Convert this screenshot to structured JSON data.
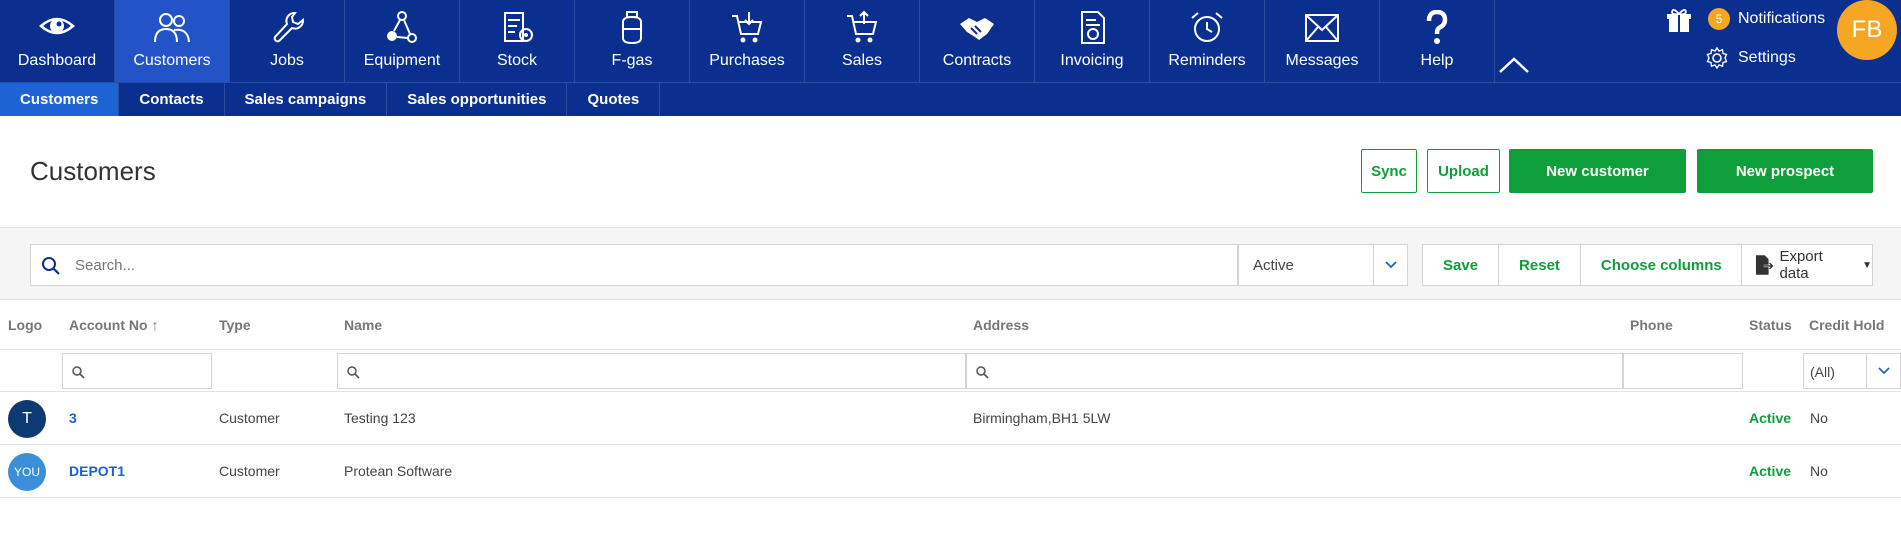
{
  "nav": {
    "items": [
      {
        "label": "Dashboard",
        "icon": "eye-icon"
      },
      {
        "label": "Customers",
        "icon": "users-icon"
      },
      {
        "label": "Jobs",
        "icon": "wrench-icon"
      },
      {
        "label": "Equipment",
        "icon": "equipment-icon"
      },
      {
        "label": "Stock",
        "icon": "stock-icon"
      },
      {
        "label": "F-gas",
        "icon": "gas-cylinder-icon"
      },
      {
        "label": "Purchases",
        "icon": "cart-in-icon"
      },
      {
        "label": "Sales",
        "icon": "cart-out-icon"
      },
      {
        "label": "Contracts",
        "icon": "handshake-icon"
      },
      {
        "label": "Invoicing",
        "icon": "invoice-icon"
      },
      {
        "label": "Reminders",
        "icon": "alarm-clock-icon"
      },
      {
        "label": "Messages",
        "icon": "envelope-icon"
      },
      {
        "label": "Help",
        "icon": "question-icon"
      }
    ],
    "active": "Customers",
    "notifications_label": "Notifications",
    "notifications_count": "5",
    "settings_label": "Settings",
    "user_initials": "FB"
  },
  "subnav": {
    "items": [
      "Customers",
      "Contacts",
      "Sales campaigns",
      "Sales opportunities",
      "Quotes"
    ],
    "active": "Customers"
  },
  "page": {
    "title": "Customers",
    "sync_label": "Sync",
    "upload_label": "Upload",
    "new_customer_label": "New customer",
    "new_prospect_label": "New prospect"
  },
  "filters": {
    "search_placeholder": "Search...",
    "status_value": "Active",
    "save_label": "Save",
    "reset_label": "Reset",
    "choose_columns_label": "Choose columns",
    "export_label": "Export data"
  },
  "table": {
    "columns": [
      "Logo",
      "Account No",
      "Type",
      "Name",
      "Address",
      "Phone",
      "Status",
      "Credit Hold"
    ],
    "credit_hold_filter": "(All)",
    "rows": [
      {
        "logo": "T",
        "logo_color": "#0d3a73",
        "account": "3",
        "type": "Customer",
        "name": "Testing 123",
        "address": "Birmingham,BH1 5LW",
        "phone": "",
        "status": "Active",
        "credit_hold": "No"
      },
      {
        "logo": "YOU",
        "logo_color": "#3a8fd8",
        "account": "DEPOT1",
        "type": "Customer",
        "name": "Protean Software",
        "address": "",
        "phone": "",
        "status": "Active",
        "credit_hold": "No"
      }
    ]
  },
  "colors": {
    "nav_bg": "#0a2f8f",
    "nav_active": "#2254c7",
    "subnav_active": "#1d63d6",
    "accent_green": "#0e9f3a",
    "badge_orange": "#f5a623",
    "link_blue": "#1d5fd1"
  }
}
